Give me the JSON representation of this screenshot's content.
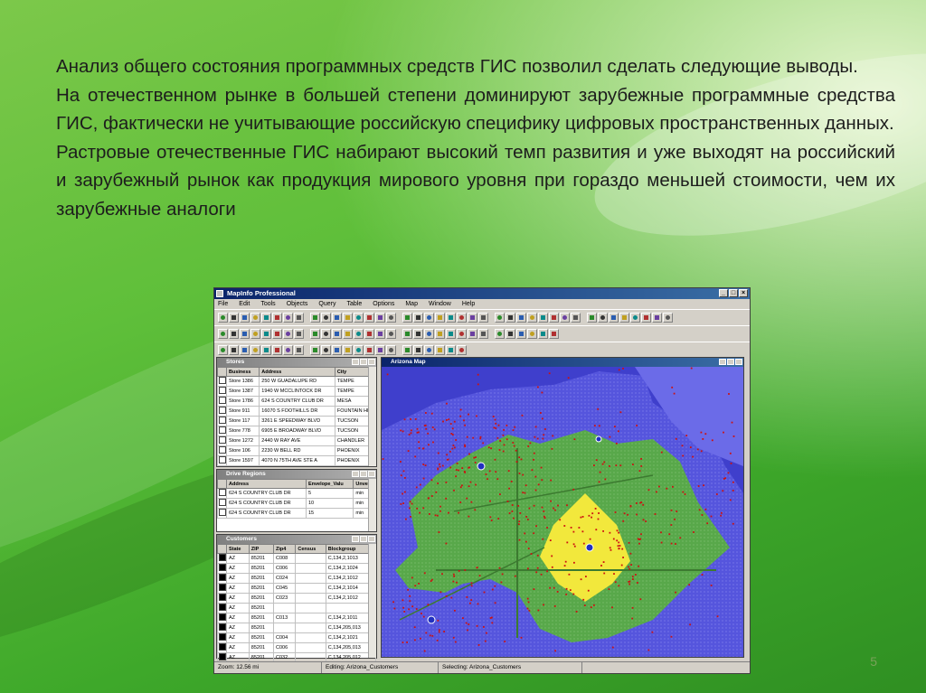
{
  "slide": {
    "paragraphs": [
      "Анализ общего состояния программных средств ГИС позволил сделать следующие выводы.",
      "На отечественном рынке в большей степени доминируют зарубежные программные средства ГИС, фактически не учитывающие российскую специфику цифровых пространственных данных.",
      "Растровые отечественные ГИС набирают высокий темп развития и уже выходят на российский и зарубежный рынок как продукция мирового уровня при гораздо меньшей стоимости, чем их зарубежные аналоги"
    ],
    "page_number": "5"
  },
  "app": {
    "title": "MapInfo Professional",
    "menu": [
      "File",
      "Edit",
      "Tools",
      "Objects",
      "Query",
      "Table",
      "Options",
      "Map",
      "Window",
      "Help"
    ]
  },
  "stores": {
    "title": "Stores",
    "columns": [
      "Business",
      "Address",
      "City"
    ],
    "rows": [
      [
        "Store 1386",
        "250 W GUADALUPE RD",
        "TEMPE"
      ],
      [
        "Store 1387",
        "1940 W MCCLINTOCK DR",
        "TEMPE"
      ],
      [
        "Store 1786",
        "624 S COUNTRY CLUB DR",
        "MESA"
      ],
      [
        "Store 911",
        "16070 S FOOTHILLS DR",
        "FOUNTAIN HI"
      ],
      [
        "Store 117",
        "3261 E SPEEDWAY BLVD",
        "TUCSON"
      ],
      [
        "Store 778",
        "6905 E BROADWAY BLVD",
        "TUCSON"
      ],
      [
        "Store 1272",
        "2440 W RAY AVE",
        "CHANDLER"
      ],
      [
        "Store 106",
        "2230 W BELL RD",
        "PHOENIX"
      ],
      [
        "Store 1597",
        "4070 N 75TH AVE STE A",
        "PHOENIX"
      ]
    ]
  },
  "drive": {
    "title": "Drive Regions",
    "columns": [
      "Address",
      "Envelope_Valu",
      "Unver"
    ],
    "rows": [
      [
        "624 S COUNTRY CLUB DR",
        "5",
        "min"
      ],
      [
        "624 S COUNTRY CLUB DR",
        "10",
        "min"
      ],
      [
        "624 S COUNTRY CLUB DR",
        "15",
        "min"
      ]
    ]
  },
  "customers": {
    "title": "Customers",
    "columns": [
      "State",
      "ZIP",
      "Zip4",
      "Census",
      "Blockgroup"
    ],
    "rows": [
      [
        "AZ",
        "85201",
        "C008",
        "",
        "C,134,2,1013"
      ],
      [
        "AZ",
        "85201",
        "C006",
        "",
        "C,134,2,1024"
      ],
      [
        "AZ",
        "85201",
        "C024",
        "",
        "C,134,2,1012"
      ],
      [
        "AZ",
        "85201",
        "C045",
        "",
        "C,134,2,1014"
      ],
      [
        "AZ",
        "85201",
        "C023",
        "",
        "C,134,2,1012"
      ],
      [
        "AZ",
        "85201",
        "",
        "",
        ""
      ],
      [
        "AZ",
        "85201",
        "C013",
        "",
        "C,134,2,1011"
      ],
      [
        "AZ",
        "85201",
        "",
        "",
        "C,134,205,013"
      ],
      [
        "AZ",
        "85201",
        "C004",
        "",
        "C,134,2,1021"
      ],
      [
        "AZ",
        "85201",
        "C006",
        "",
        "C,134,205,013"
      ],
      [
        "AZ",
        "85201",
        "C032",
        "",
        "C,134,205,012"
      ],
      [
        "AZ",
        "85201",
        "",
        "",
        "C,134,2,1012"
      ]
    ]
  },
  "map": {
    "title": "Arizona Map"
  },
  "status": {
    "zoom": "Zoom: 12.56 mi",
    "editing": "Editing: Arizona_Customers",
    "selecting": "Selecting: Arizona_Customers"
  },
  "colors": {
    "region_outer": "#5555dd",
    "region_mid": "#5aa84a",
    "region_inner": "#f2e83c",
    "points": "#cc1111"
  }
}
